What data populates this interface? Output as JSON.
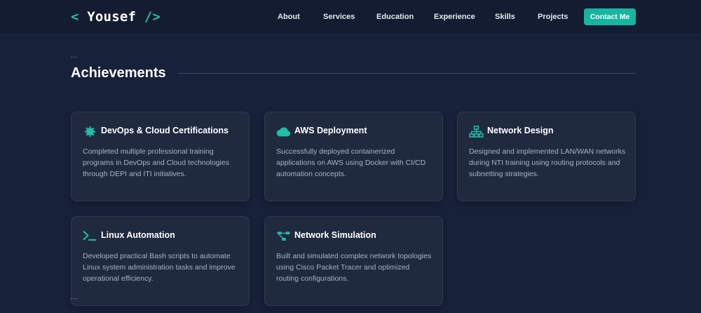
{
  "brand": {
    "open": "< ",
    "name": "Yousef",
    "close": " />",
    "accent": "#1fbfa6"
  },
  "nav": {
    "links": [
      "About",
      "Services",
      "Education",
      "Experience",
      "Skills",
      "Projects"
    ],
    "cta": "Contact Me"
  },
  "section": {
    "dots_top": "...",
    "title": "Achievements",
    "dots_bottom": "..."
  },
  "cards": [
    {
      "icon": "gear-icon",
      "title": "DevOps & Cloud Certifications",
      "description": "Completed multiple professional training programs in DevOps and Cloud technologies through DEPI and ITI initiatives."
    },
    {
      "icon": "cloud-icon",
      "title": "AWS Deployment",
      "description": "Successfully deployed containerized applications on AWS using Docker with CI/CD automation concepts."
    },
    {
      "icon": "network-icon",
      "title": "Network Design",
      "description": "Designed and implemented LAN/WAN networks during NTI training using routing protocols and subnetting strategies."
    },
    {
      "icon": "terminal-icon",
      "title": "Linux Automation",
      "description": "Developed practical Bash scripts to automate Linux system administration tasks and improve operational efficiency."
    },
    {
      "icon": "diagram-icon",
      "title": "Network Simulation",
      "description": "Built and simulated complex network topologies using Cisco Packet Tracer and optimized routing configurations."
    }
  ]
}
